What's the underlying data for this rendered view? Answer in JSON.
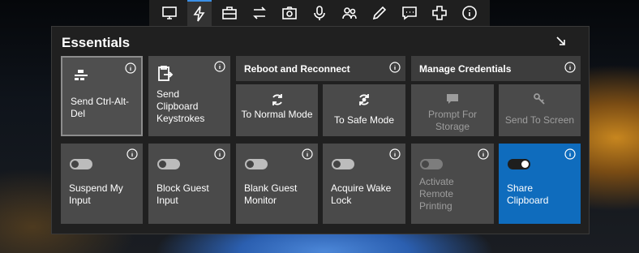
{
  "toolbar": {
    "buttons": [
      {
        "icon": "monitor-icon"
      },
      {
        "icon": "lightning-icon",
        "active": true
      },
      {
        "icon": "briefcase-icon"
      },
      {
        "icon": "swap-arrows-icon"
      },
      {
        "icon": "camera-icon"
      },
      {
        "icon": "microphone-icon"
      },
      {
        "icon": "users-icon"
      },
      {
        "icon": "pencil-icon"
      },
      {
        "icon": "chat-icon"
      },
      {
        "icon": "plus-icon"
      },
      {
        "icon": "info-icon"
      }
    ]
  },
  "panel": {
    "title": "Essentials",
    "tiles": {
      "send_cad": "Send Ctrl-Alt-Del",
      "send_clipboard": "Send Clipboard Keystrokes",
      "reboot_group": "Reboot and Reconnect",
      "normal_mode": "To Normal Mode",
      "safe_mode": "To Safe Mode",
      "credentials_group": "Manage Credentials",
      "prompt_storage": "Prompt For Storage",
      "send_screen": "Send To Screen",
      "suspend_input": "Suspend My Input",
      "block_input": "Block Guest Input",
      "blank_monitor": "Blank Guest Monitor",
      "wake_lock": "Acquire Wake Lock",
      "remote_printing": "Activate Remote Printing",
      "share_clipboard": "Share Clipboard"
    },
    "toggles": {
      "suspend_input": false,
      "block_input": false,
      "blank_monitor": false,
      "wake_lock": false,
      "remote_printing": false,
      "share_clipboard": true
    }
  },
  "colors": {
    "accent": "#0f6cbd",
    "tile": "#4a4a4a",
    "panel": "#202020"
  }
}
